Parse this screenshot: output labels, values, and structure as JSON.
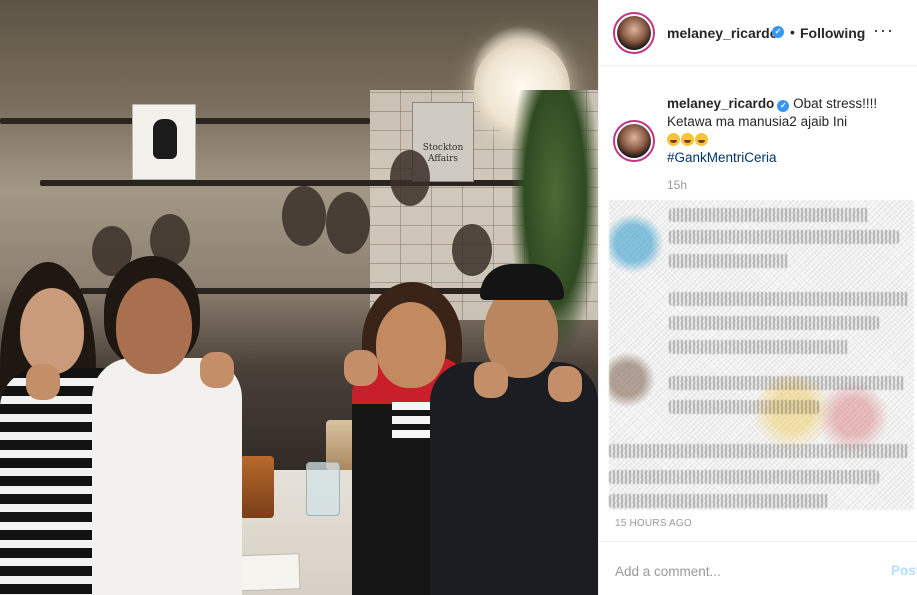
{
  "post": {
    "photo_alt": "Group photo at a café",
    "book_title": "Stockton Affairs"
  },
  "header": {
    "username": "melaney_ricardo",
    "verified_glyph": "✓",
    "separator": "•",
    "follow_status": "Following",
    "more_icon": "···"
  },
  "caption": {
    "author": "melaney_ricardo",
    "text_line1": "Obat stress!!!!",
    "text_line2": "Ketawa ma manusia2 ajaib Ini",
    "emoji_count": 3,
    "hashtag": "#GankMentriCeria",
    "relative_time": "15h"
  },
  "comments": {
    "blurred": true
  },
  "footer": {
    "timestamp": "15 HOURS AGO",
    "comment_placeholder": "Add a comment...",
    "post_label": "Post"
  },
  "colors": {
    "verified": "#3897f0",
    "hashtag": "#003569",
    "post_disabled": "#b2dffc",
    "muted": "#999999",
    "story_ring": "#c13584"
  }
}
